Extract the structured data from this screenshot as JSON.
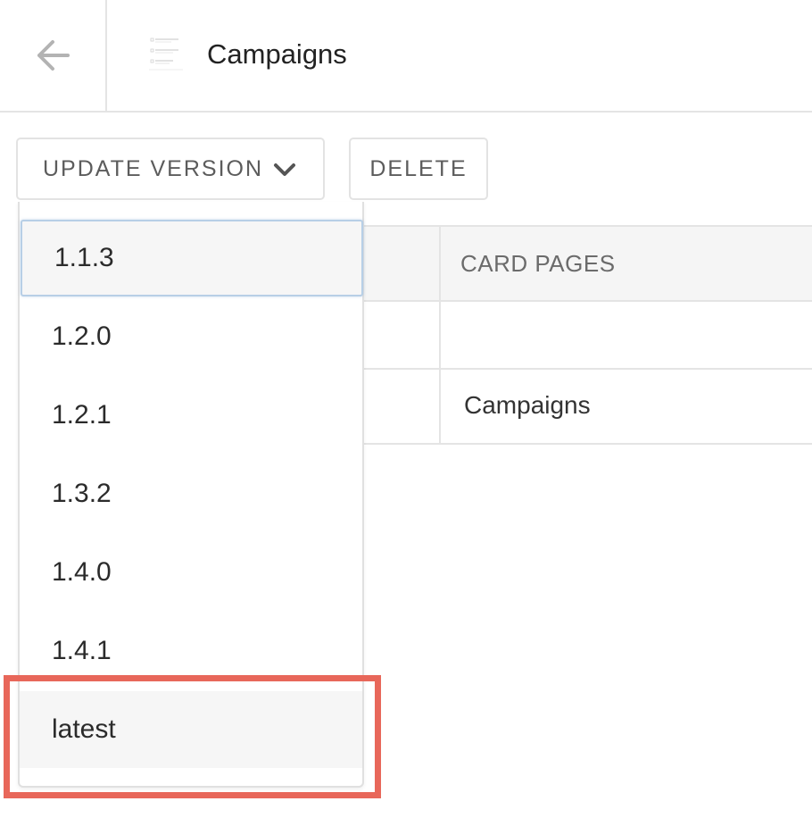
{
  "header": {
    "title": "Campaigns",
    "back_icon": "arrow-left-icon",
    "thumbnail_icon": "page-thumbnail-icon"
  },
  "toolbar": {
    "update_label": "UPDATE VERSION",
    "update_icon": "chevron-down-icon",
    "delete_label": "DELETE"
  },
  "table": {
    "column_header": "CARD PAGES",
    "rows": [
      "",
      "Campaigns"
    ]
  },
  "dropdown": {
    "options": [
      "1.1.3",
      "1.2.0",
      "1.2.1",
      "1.3.2",
      "1.4.0",
      "1.4.1",
      "latest"
    ],
    "focused": "1.1.3",
    "hovered": "latest"
  },
  "colors": {
    "highlight": "#e8675a",
    "focus_border": "#b7cfe6",
    "option_bg": "#f6f6f6",
    "border": "#e4e4e4"
  }
}
